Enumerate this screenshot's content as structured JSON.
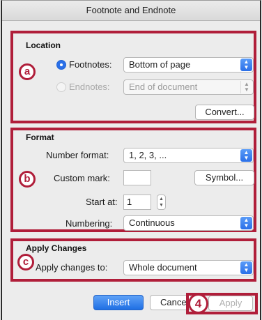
{
  "window": {
    "title": "Footnote and Endnote"
  },
  "markers": {
    "a": "a",
    "b": "b",
    "c": "c",
    "step": "4"
  },
  "location": {
    "heading": "Location",
    "footnotes_label": "Footnotes:",
    "footnotes_value": "Bottom of page",
    "footnotes_selected": true,
    "endnotes_label": "Endnotes:",
    "endnotes_value": "End of document",
    "endnotes_enabled": false,
    "convert_button": "Convert..."
  },
  "format": {
    "heading": "Format",
    "number_format_label": "Number format:",
    "number_format_value": "1, 2, 3, ...",
    "custom_mark_label": "Custom mark:",
    "custom_mark_value": "",
    "symbol_button": "Symbol...",
    "start_at_label": "Start at:",
    "start_at_value": "1",
    "numbering_label": "Numbering:",
    "numbering_value": "Continuous"
  },
  "apply_changes": {
    "heading": "Apply Changes",
    "apply_to_label": "Apply changes to:",
    "apply_to_value": "Whole document"
  },
  "footer": {
    "insert_button": "Insert",
    "cancel_button": "Cance",
    "apply_button": "Apply",
    "apply_enabled": false
  },
  "colors": {
    "annotation_red": "#b01e3a",
    "accent_blue": "#2a6fe8",
    "dialog_bg": "#ececec"
  }
}
